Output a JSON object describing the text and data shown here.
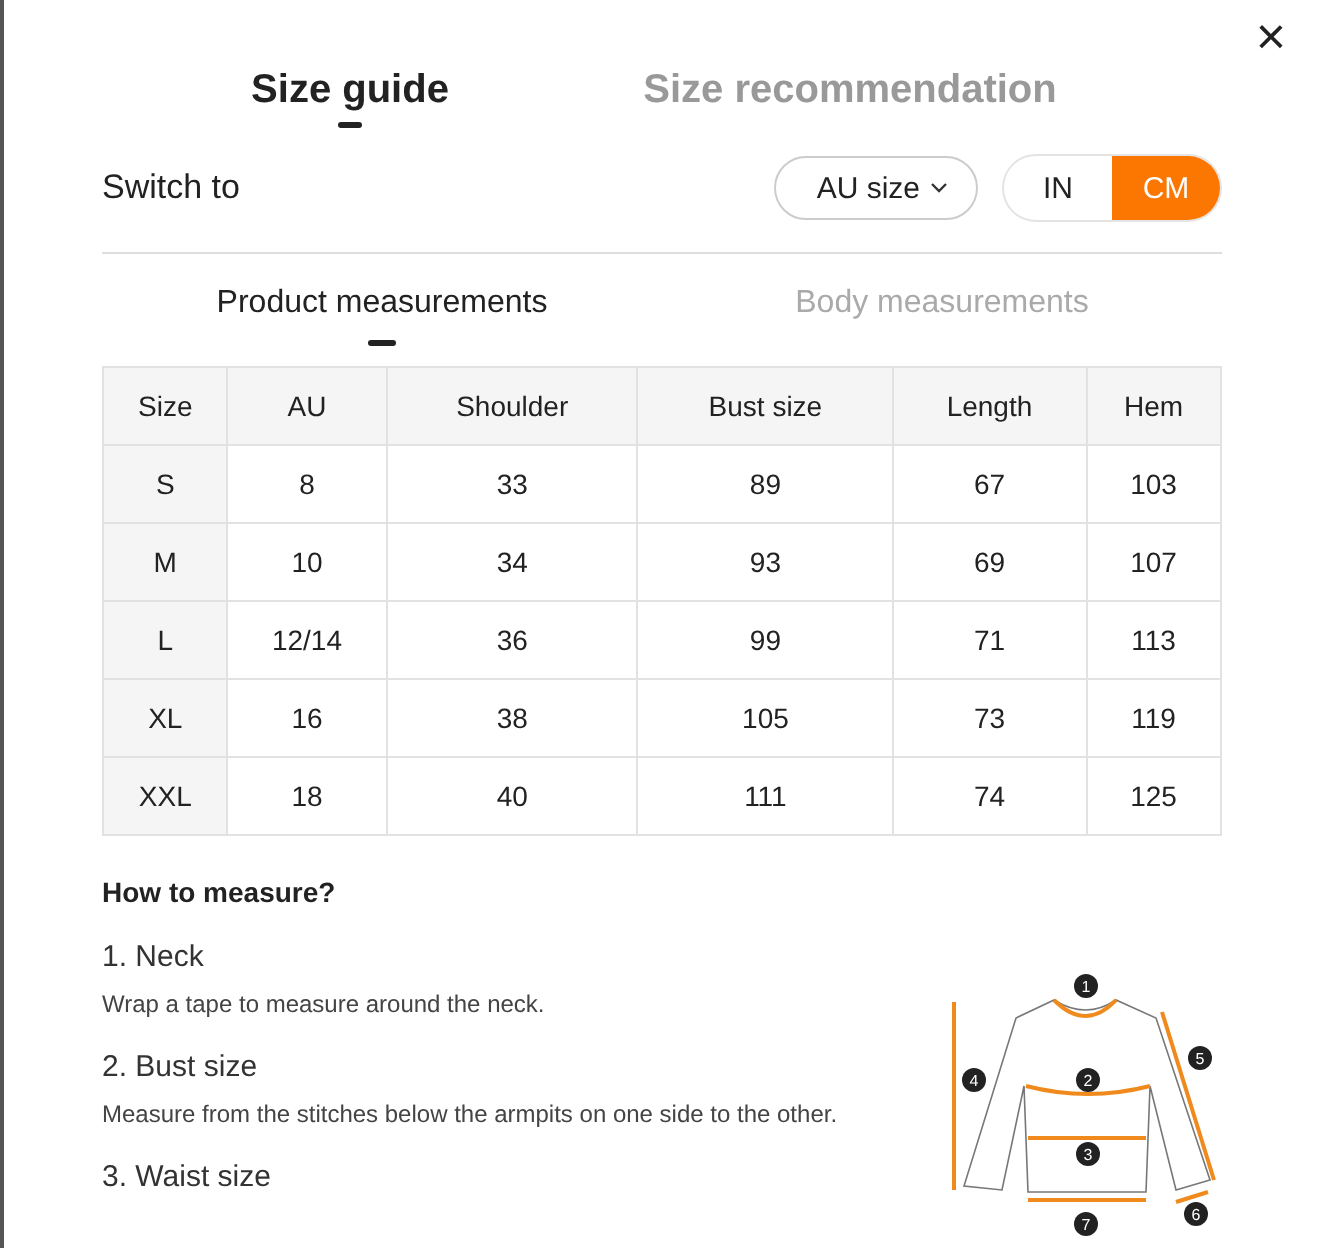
{
  "close_label": "×",
  "main_tabs": [
    {
      "label": "Size guide",
      "selected": true
    },
    {
      "label": "Size recommendation",
      "selected": false
    }
  ],
  "switch": {
    "label": "Switch to",
    "region": "AU size",
    "units": [
      {
        "label": "IN",
        "selected": false
      },
      {
        "label": "CM",
        "selected": true
      }
    ]
  },
  "sub_tabs": [
    {
      "label": "Product measurements",
      "selected": true
    },
    {
      "label": "Body measurements",
      "selected": false
    }
  ],
  "table": {
    "columns": [
      "Size",
      "AU",
      "Shoulder",
      "Bust size",
      "Length",
      "Hem"
    ],
    "rows": [
      [
        "S",
        "8",
        "33",
        "89",
        "67",
        "103"
      ],
      [
        "M",
        "10",
        "34",
        "93",
        "69",
        "107"
      ],
      [
        "L",
        "12/14",
        "36",
        "99",
        "71",
        "113"
      ],
      [
        "XL",
        "16",
        "38",
        "105",
        "73",
        "119"
      ],
      [
        "XXL",
        "18",
        "40",
        "111",
        "74",
        "125"
      ]
    ]
  },
  "how_to": {
    "title": "How to measure?",
    "steps": [
      {
        "title": "1. Neck",
        "text": "Wrap a tape to measure around the neck."
      },
      {
        "title": "2. Bust size",
        "text": "Measure from the stitches below the armpits on one side to the other."
      },
      {
        "title": "3. Waist size"
      }
    ]
  },
  "diagram_labels": [
    "1",
    "2",
    "3",
    "4",
    "5",
    "6",
    "7"
  ]
}
